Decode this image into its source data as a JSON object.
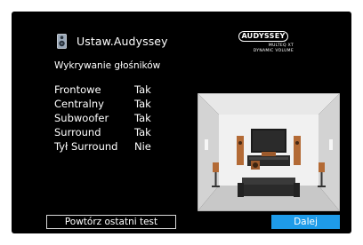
{
  "header": {
    "title": "Ustaw.Audyssey",
    "subtitle": "Wykrywanie głośników"
  },
  "logo": {
    "brand": "AUDYSSEY",
    "line1": "MULTEQ XT",
    "line2": "DYNAMIC VOLUME"
  },
  "speakers": [
    {
      "label": "Frontowe",
      "value": "Tak"
    },
    {
      "label": "Centralny",
      "value": "Tak"
    },
    {
      "label": "Subwoofer",
      "value": "Tak"
    },
    {
      "label": "Surround",
      "value": "Tak"
    },
    {
      "label": "Tył Surround",
      "value": "Nie"
    }
  ],
  "buttons": {
    "retest": "Powtórz ostatni test",
    "next": "Dalej"
  },
  "colors": {
    "background": "#000000",
    "accent_button": "#1e9be9",
    "text": "#ffffff"
  },
  "icons": {
    "title_icon": "speaker-icon",
    "illustration": "room-speaker-layout-illustration"
  }
}
